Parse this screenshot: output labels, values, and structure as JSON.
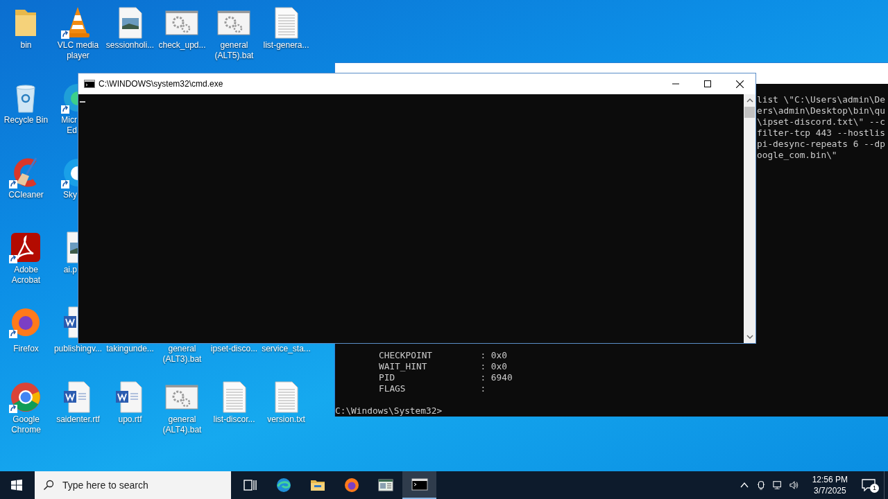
{
  "desktop_icons": [
    {
      "label": "bin",
      "kind": "folder",
      "shortcut": false
    },
    {
      "label": "Recycle Bin",
      "kind": "recycle-bin",
      "shortcut": false
    },
    {
      "label": "CCleaner",
      "kind": "ccleaner",
      "shortcut": true
    },
    {
      "label": "Adobe Acrobat",
      "kind": "acrobat",
      "shortcut": true
    },
    {
      "label": "Firefox",
      "kind": "firefox",
      "shortcut": true
    },
    {
      "label": "Google Chrome",
      "kind": "chrome",
      "shortcut": true
    },
    {
      "label": "VLC media player",
      "kind": "vlc",
      "shortcut": true
    },
    {
      "label": "Micr Ed",
      "kind": "edge",
      "shortcut": true
    },
    {
      "label": "Sky",
      "kind": "skype",
      "shortcut": true
    },
    {
      "label": "ai.p",
      "kind": "image-file",
      "shortcut": false
    },
    {
      "label": "publishingv...",
      "kind": "word-file",
      "shortcut": false
    },
    {
      "label": "saidenter.rtf",
      "kind": "word-file",
      "shortcut": false
    },
    {
      "label": "sessionholi...",
      "kind": "image-file",
      "shortcut": false
    },
    {
      "label": "takingunde...",
      "kind": "hidden"
    },
    {
      "label": "upo.rtf",
      "kind": "word-file",
      "shortcut": false
    },
    {
      "label": "check_upd...",
      "kind": "batch-file",
      "shortcut": false
    },
    {
      "label": "general (ALT3).bat",
      "kind": "hidden"
    },
    {
      "label": "general (ALT4).bat",
      "kind": "batch-file",
      "shortcut": false
    },
    {
      "label": "general (ALT5).bat",
      "kind": "batch-file",
      "shortcut": false
    },
    {
      "label": "ipset-disco...",
      "kind": "hidden"
    },
    {
      "label": "list-discor...",
      "kind": "text-file",
      "shortcut": false
    },
    {
      "label": "list-genera...",
      "kind": "text-file",
      "shortcut": false
    },
    {
      "label": "service_sta...",
      "kind": "hidden"
    },
    {
      "label": "version.txt",
      "kind": "text-file",
      "shortcut": false
    }
  ],
  "console_back": {
    "right_lines": [
      "list \\\"C:\\Users\\admin\\De",
      "ers\\admin\\Desktop\\bin\\qu",
      "\\ipset-discord.txt\\\" --c",
      "filter-tcp 443 --hostlis",
      "pi-desync-repeats 6 --dp",
      "oogle_com.bin\\\""
    ],
    "bottom_lines": [
      "CHECKPOINT         : 0x0",
      "WAIT_HINT          : 0x0",
      "PID                : 6940",
      "FLAGS              :"
    ],
    "prompt": "C:\\Windows\\System32>"
  },
  "console_front": {
    "title": "C:\\WINDOWS\\system32\\cmd.exe"
  },
  "taskbar": {
    "search_placeholder": "Type here to search",
    "apps": [
      {
        "kind": "task-view",
        "selected": false
      },
      {
        "kind": "edge",
        "selected": false
      },
      {
        "kind": "explorer",
        "selected": false
      },
      {
        "kind": "firefox",
        "selected": false
      },
      {
        "kind": "app-window",
        "selected": false
      },
      {
        "kind": "cmd",
        "selected": true
      }
    ],
    "time": "12:56 PM",
    "date": "3/7/2025",
    "notification_count": "1"
  }
}
